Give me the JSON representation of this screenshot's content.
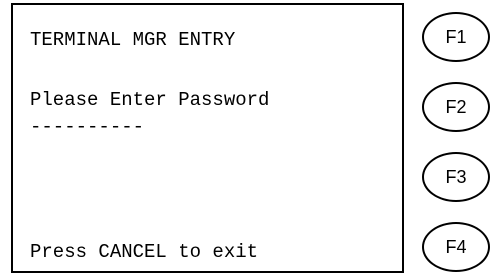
{
  "screen": {
    "title": "TERMINAL MGR ENTRY",
    "prompt": "Please Enter Password",
    "password_mask": "----------",
    "footer": "Press CANCEL to exit"
  },
  "function_keys": [
    {
      "label": "F1"
    },
    {
      "label": "F2"
    },
    {
      "label": "F3"
    },
    {
      "label": "F4"
    }
  ]
}
